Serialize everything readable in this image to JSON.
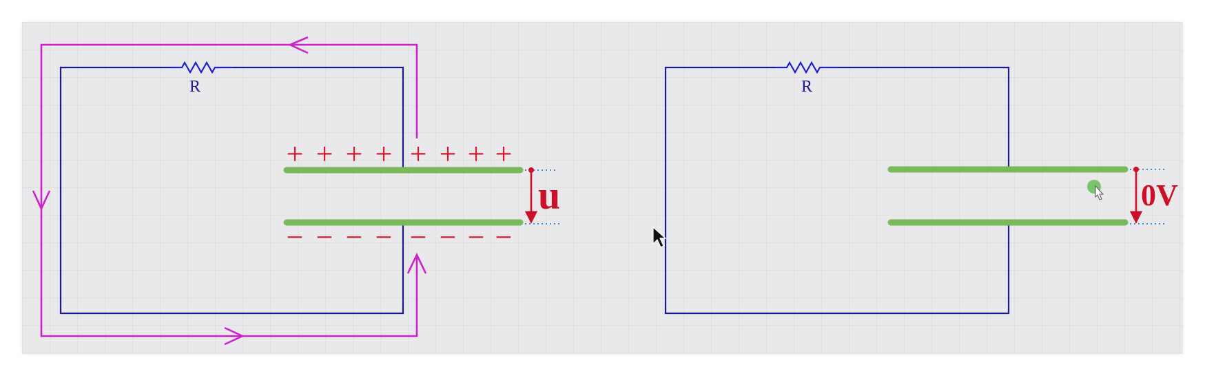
{
  "colors": {
    "wire": "#1a1a8c",
    "current_arrow": "#cc22cc",
    "plate": "#78b95a",
    "charge": "#d4182f",
    "voltage_arrow": "#cc1028",
    "dotted_guide": "#3a8fd6",
    "cursor_dot": "#6fbf5f"
  },
  "left_circuit": {
    "resistor_label": "R",
    "plus_signs": [
      "+",
      "+",
      "+",
      "+",
      "+",
      "+",
      "+",
      "+"
    ],
    "minus_signs": [
      "−",
      "−",
      "−",
      "−",
      "−",
      "−",
      "−",
      "−"
    ],
    "voltage_label": "u"
  },
  "right_circuit": {
    "resistor_label": "R",
    "voltage_label": "0V"
  },
  "icons": {
    "pointer": "mouse-pointer-icon",
    "hand": "hand-cursor-icon"
  }
}
